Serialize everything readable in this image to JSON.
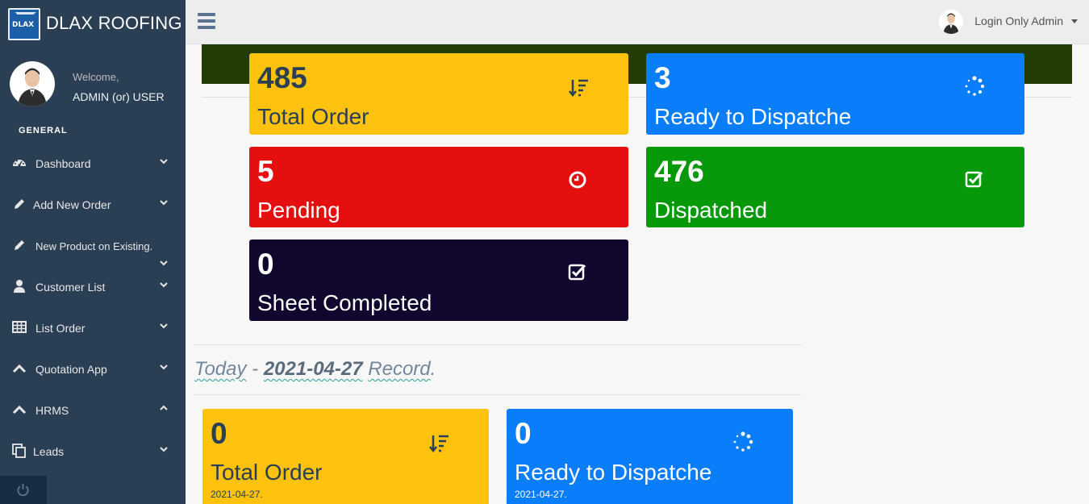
{
  "brand": {
    "title": "DLAX ROOFING",
    "logo_text": "DLAX"
  },
  "profile": {
    "welcome": "Welcome,",
    "name": "ADMIN (or) USER"
  },
  "sidebar": {
    "section_title": "GENERAL",
    "items": [
      {
        "label": "Dashboard",
        "icon": "dashboard-icon"
      },
      {
        "label": "Add New Order",
        "icon": "pencil-icon"
      },
      {
        "label": "New Product on Existing.",
        "icon": "pencil-icon"
      },
      {
        "label": "Customer List",
        "icon": "user-icon"
      },
      {
        "label": "List Order",
        "icon": "table-icon"
      },
      {
        "label": "Quotation App",
        "icon": "chevron-up-icon"
      },
      {
        "label": "HRMS",
        "icon": "chevron-up-icon"
      },
      {
        "label": "Leads",
        "icon": "copy-icon"
      }
    ]
  },
  "topnav": {
    "user_label": "Login Only Admin"
  },
  "summary_tiles": [
    {
      "count": "485",
      "label": "Total Order",
      "icon": "sort-amount-down-icon",
      "bg": "#fdc20e",
      "fg": "#2a3f54"
    },
    {
      "count": "3",
      "label": "Ready to Dispatche",
      "icon": "spinner-icon",
      "bg": "#0a7dfb",
      "fg": "#ffffff"
    },
    {
      "count": "5",
      "label": "Pending",
      "icon": "clock-icon",
      "bg": "#e60f0f",
      "fg": "#ffffff"
    },
    {
      "count": "476",
      "label": "Dispatched",
      "icon": "check-square-icon",
      "bg": "#07990a",
      "fg": "#ffffff"
    },
    {
      "count": "0",
      "label": "Sheet Completed",
      "icon": "check-square-icon",
      "bg": "#10062e",
      "fg": "#ffffff"
    }
  ],
  "today": {
    "prefix": "Today",
    "dash": " - ",
    "date": "2021-04-27",
    "suffix": "Record",
    "period": "."
  },
  "today_tiles": [
    {
      "count": "0",
      "label": "Total Order",
      "date": "2021-04-27.",
      "icon": "sort-amount-down-icon",
      "bg": "#fdc20e",
      "fg": "#2a3f54"
    },
    {
      "count": "0",
      "label": "Ready to Dispatche",
      "date": "2021-04-27.",
      "icon": "spinner-icon",
      "bg": "#0a7dfb",
      "fg": "#ffffff"
    }
  ]
}
